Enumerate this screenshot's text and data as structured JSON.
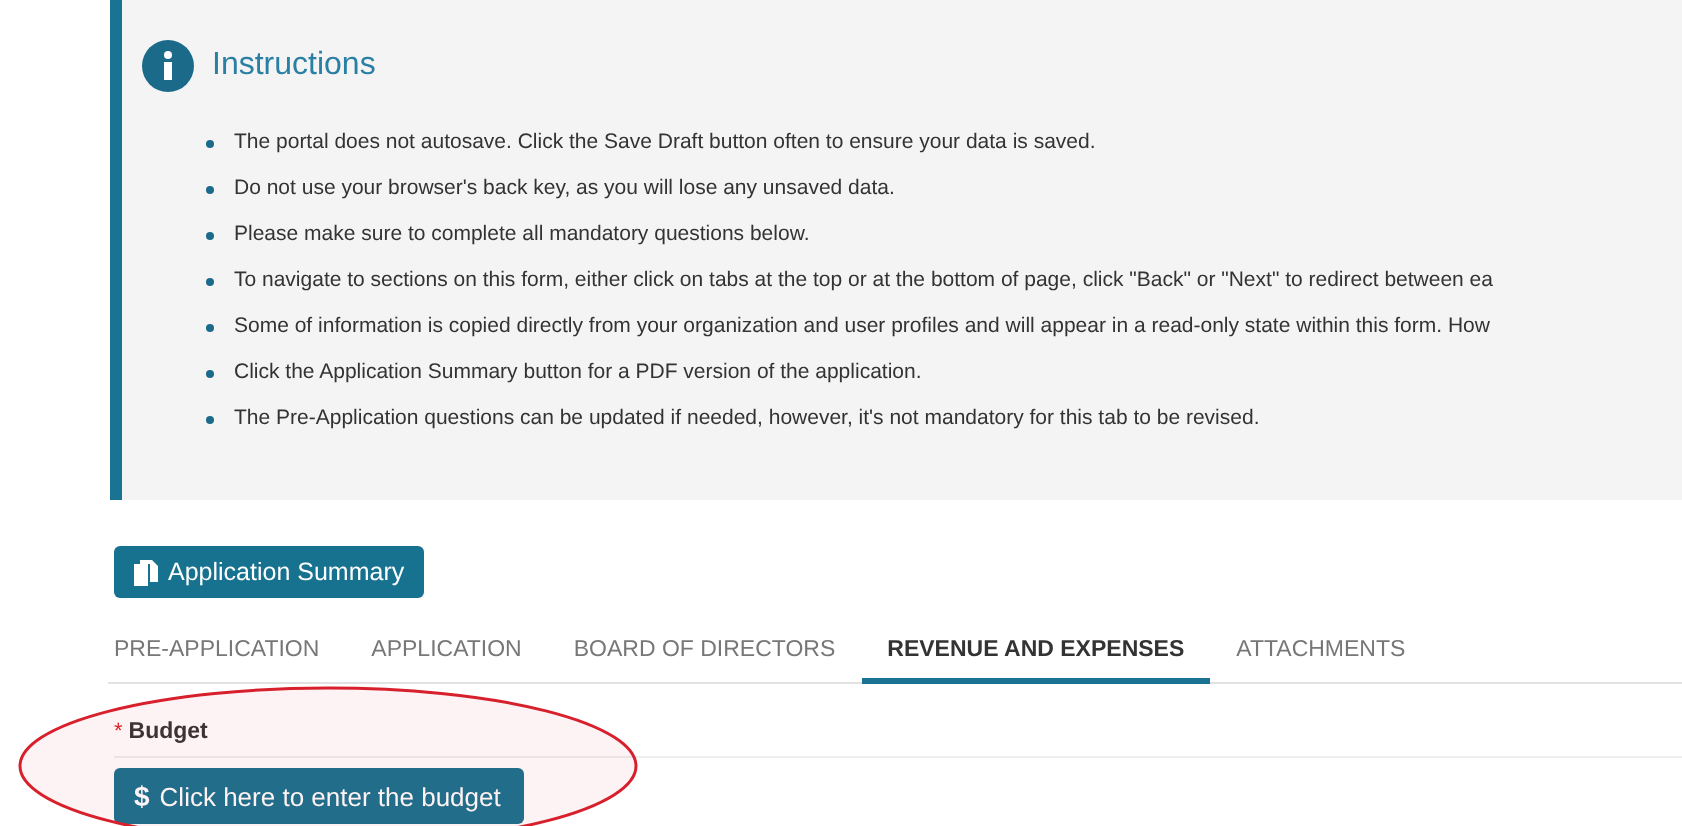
{
  "instructions": {
    "title": "Instructions",
    "items": [
      "The portal does not autosave. Click the Save Draft button often to ensure your data is saved.",
      "Do not use your browser's back key, as you will lose any unsaved data.",
      "Please make sure to complete all mandatory questions below.",
      "To navigate to sections on this form, either click on tabs at the top or at the bottom of page, click \"Back\" or \"Next\" to redirect between ea",
      "Some of information is copied directly from your organization and user profiles and will appear in a read-only state within this form. How",
      "Click the Application Summary button for a PDF version of the application.",
      "The Pre-Application questions can be updated if needed, however, it's not mandatory for this tab to be revised."
    ]
  },
  "summary_button": "Application Summary",
  "tabs": [
    {
      "label": "PRE-APPLICATION",
      "selected": false
    },
    {
      "label": "APPLICATION",
      "selected": false
    },
    {
      "label": "BOARD OF DIRECTORS",
      "selected": false
    },
    {
      "label": "REVENUE AND EXPENSES",
      "selected": true
    },
    {
      "label": "ATTACHMENTS",
      "selected": false
    }
  ],
  "budget": {
    "required_mark": "*",
    "label": "Budget",
    "button_icon": "$",
    "button": "Click here to enter the budget"
  }
}
